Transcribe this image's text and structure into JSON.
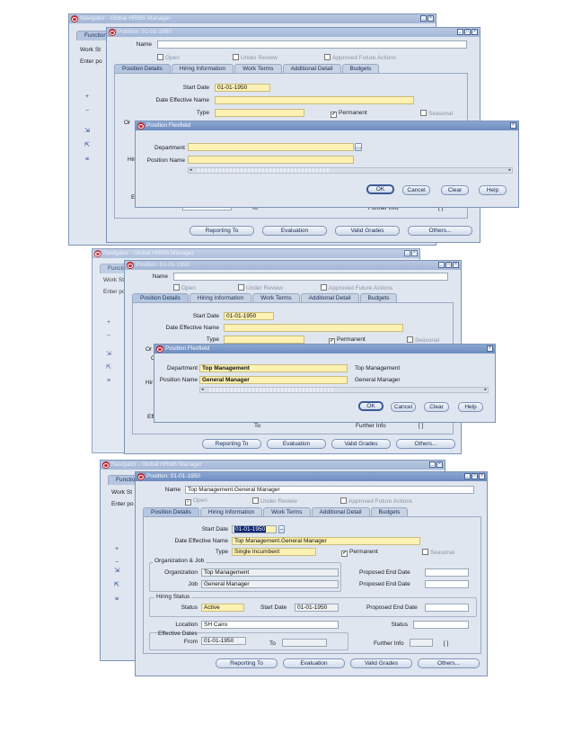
{
  "navigator": {
    "title": "Navigator - Global HRMS Manager",
    "functions_tab": "Functions",
    "work_label": "Work St",
    "enter_label": "Enter po"
  },
  "position_form": {
    "title_1": "Position: 01-01-1950",
    "title_3": "Position: 01-01-1950",
    "name_label": "Name",
    "name_value_3": "Top Management.General Manager",
    "chk_open": "Open",
    "chk_under_review": "Under Review",
    "chk_approved": "Approved Future Actions",
    "tabs": [
      "Position Details",
      "Hiring Information",
      "Work Terms",
      "Additional Detail",
      "Budgets"
    ],
    "start_date_label": "Start Date",
    "start_date": "01-01-1950",
    "date_effective_name_label": "Date Effective Name",
    "date_effective_name_3": "Top Management.General Manager",
    "type_label": "Type",
    "type_value_3": "Single Incumbent",
    "permanent": "Permanent",
    "seasonal": "Seasonal",
    "org_job_group": "Organization & Job",
    "organization_label": "Organization",
    "organization_value": "Top Management",
    "job_label": "Job",
    "job_value": "General Manager",
    "proposed_end_date": "Proposed End Date",
    "hiring_status_group": "Hiring Status",
    "status_label": "Status",
    "status_value": "Active",
    "hs_start_date_label": "Start Date",
    "hs_start_date": "01-01-1950",
    "location_label": "Location",
    "location_value": "SH Cairo",
    "status2_label": "Status",
    "effective_dates_label": "Effective Dates",
    "from_label": "From",
    "from_value": "01-01-1950",
    "to_label": "To",
    "further_info_label": "Further Info",
    "further_info_box": "[  ]",
    "frag_org": "Or",
    "frag_c": "C",
    "frag_hir": "Hir",
    "frag_eff": "Eff",
    "frag_from": "From",
    "frag_to": "To",
    "buttons": {
      "reporting_to": "Reporting To",
      "evaluation": "Evaluation",
      "valid_grades": "Valid Grades",
      "others": "Others..."
    }
  },
  "flexfield": {
    "title": "Position Flexfield",
    "department_label": "Department",
    "position_name_label": "Position Name",
    "department_value_2": "Top Management",
    "position_value_2": "General Manager",
    "department_desc_2": "Top Management",
    "position_desc_2": "General Manager",
    "buttons": {
      "ok": "OK",
      "cancel": "Cancel",
      "clear": "Clear",
      "help": "Help"
    }
  },
  "icons": [
    "oracle-icon",
    "minimize-icon",
    "maximize-icon",
    "close-icon",
    "lov-icon"
  ]
}
